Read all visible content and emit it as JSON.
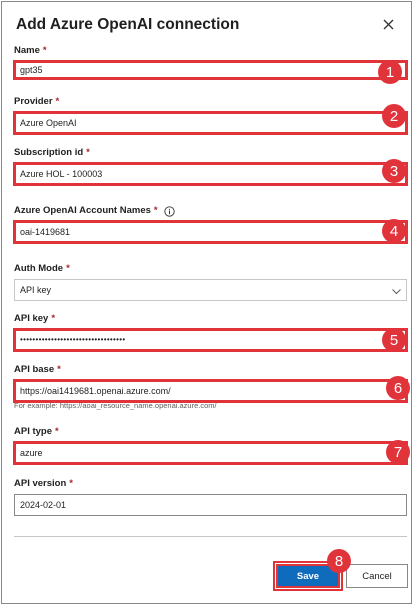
{
  "dialog": {
    "title": "Add Azure OpenAI connection"
  },
  "fields": {
    "name": {
      "label": "Name",
      "required": "*",
      "value": "gpt35"
    },
    "provider": {
      "label": "Provider",
      "required": "*",
      "value": "Azure OpenAI"
    },
    "subscription": {
      "label": "Subscription id",
      "required": "*",
      "value": "Azure HOL - 100003"
    },
    "account": {
      "label": "Azure OpenAI Account Names",
      "required": "*",
      "value": "oai-1419681"
    },
    "auth_mode": {
      "label": "Auth Mode",
      "required": "*",
      "value": "API key"
    },
    "api_key": {
      "label": "API key",
      "required": "*",
      "value": "••••••••••••••••••••••••••••••••••"
    },
    "api_base": {
      "label": "API base",
      "required": "*",
      "value": "https://oai1419681.openai.azure.com/",
      "hint": "For example: https://aoai_resource_name.openai.azure.com/"
    },
    "api_type": {
      "label": "API type",
      "required": "*",
      "value": "azure"
    },
    "api_version": {
      "label": "API version",
      "required": "*",
      "value": "2024-02-01"
    }
  },
  "badges": [
    "1",
    "2",
    "3",
    "4",
    "5",
    "6",
    "7",
    "8"
  ],
  "buttons": {
    "save": "Save",
    "cancel": "Cancel"
  },
  "colors": {
    "highlight": "#e1333a",
    "primary": "#0f6cbd",
    "required": "#a4262c"
  }
}
